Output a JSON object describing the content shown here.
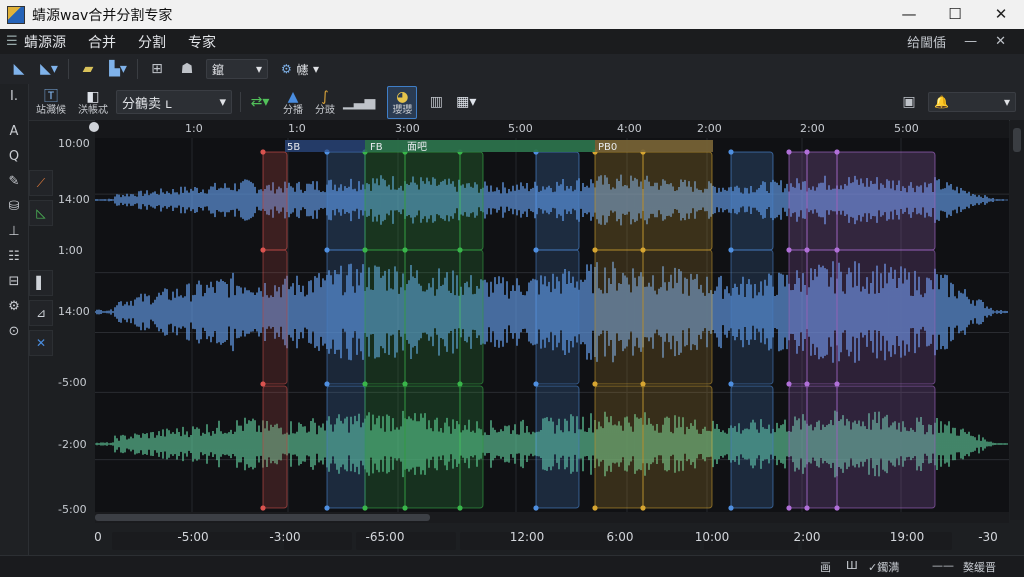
{
  "window": {
    "title": "蜻源wav合并分割专家",
    "controls": [
      "—",
      "☐",
      "✕"
    ]
  },
  "menu": {
    "items": [
      "蜻源源",
      "合并",
      "分割",
      "专家"
    ],
    "right_text": "给閫偛",
    "right_icons": [
      "—",
      "✕"
    ]
  },
  "toolbar1": {
    "zoom_dropdown": "鑹",
    "mode_dropdown": "幰"
  },
  "toolbar2": {
    "btn1_label": "站濺候",
    "btn2_label": "浂帳忒",
    "preset_dropdown": "分鶴卖 ʟ",
    "btn_split_label": "分播",
    "btn_split2_label": "分豉",
    "btn_active_label": "瓔瓔",
    "right_dropdown": ""
  },
  "left_tools": [
    "I.",
    "A",
    "Q",
    "✎",
    "⛁",
    "⊥",
    "☷",
    "⊟",
    "⚙",
    "⊙"
  ],
  "y_axis_labels": [
    "10:00",
    "14:00",
    "1:00",
    "14:00",
    "-5:00",
    "-2:00",
    "-5:00"
  ],
  "ruler": {
    "ticks": [
      "1:0",
      "1:0",
      "3:00",
      "5:00",
      "4:00",
      "2:00",
      "2:00",
      "5:00"
    ]
  },
  "segment_labels": [
    "5B",
    "FB",
    "面吧",
    "PB0"
  ],
  "x_axis_labels": [
    "0",
    "-5:00",
    "-3:00",
    "-65:00",
    "12:00",
    "6:00",
    "10:00",
    "2:00",
    "19:00",
    "-30"
  ],
  "status": {
    "items": [
      "画",
      "Ш",
      "✓鐲满",
      "——",
      "獒缓晋"
    ]
  },
  "colors": {
    "wave_blue": "#5b8fd4",
    "wave_green": "#55b38a",
    "seg_red": "#d9534f",
    "seg_blue": "#4f8fe0",
    "seg_green": "#39b54a",
    "seg_yellow": "#d6a531",
    "seg_purple": "#b070d8"
  }
}
